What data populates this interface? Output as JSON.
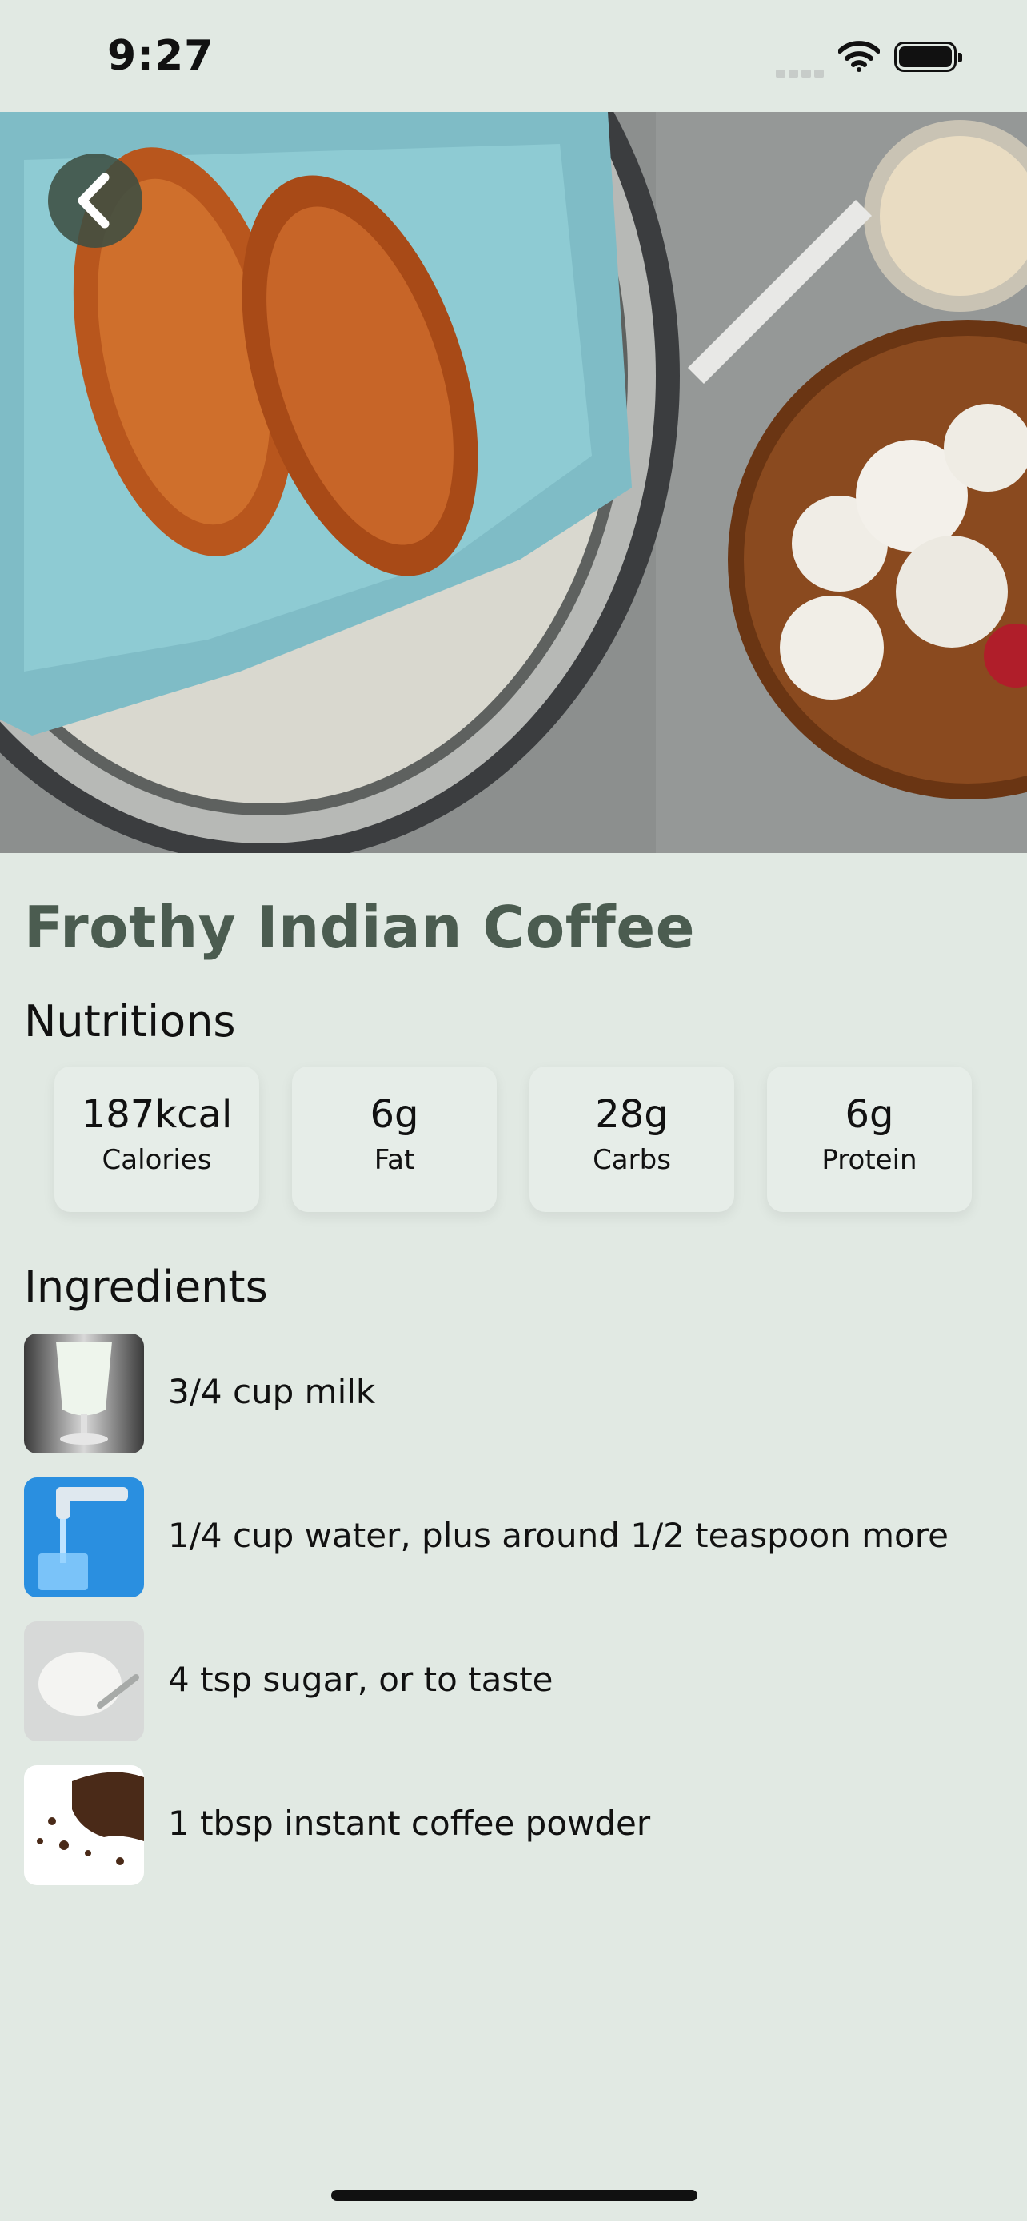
{
  "status_bar": {
    "time": "9:27"
  },
  "hero": {
    "image_name": "croissants-and-coffee"
  },
  "recipe": {
    "title": "Frothy Indian Coffee"
  },
  "nutrition": {
    "heading": "Nutritions",
    "items": [
      {
        "value": "187kcal",
        "label": "Calories"
      },
      {
        "value": "6g",
        "label": "Fat"
      },
      {
        "value": "28g",
        "label": "Carbs"
      },
      {
        "value": "6g",
        "label": "Protein"
      }
    ]
  },
  "ingredients": {
    "heading": "Ingredients",
    "items": [
      {
        "text": "3/4 cup milk",
        "icon": "milk-glass"
      },
      {
        "text": "1/4 cup water, plus around 1/2 teaspoon more",
        "icon": "water-tap"
      },
      {
        "text": "4 tsp sugar, or to taste",
        "icon": "sugar-spoon"
      },
      {
        "text": "1 tbsp instant coffee powder",
        "icon": "coffee-granules"
      }
    ]
  },
  "colors": {
    "background": "#e1e9e3",
    "title": "#4b5c50",
    "back_button": "#3e4e42"
  }
}
